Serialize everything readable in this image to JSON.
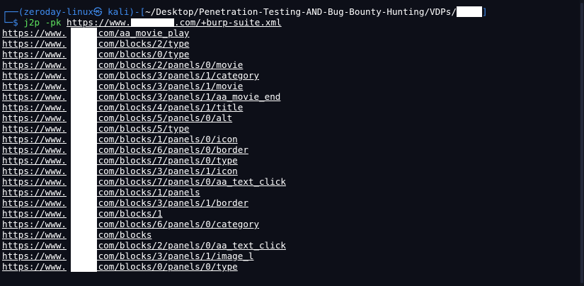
{
  "prompt": {
    "frame_top": "┌──(",
    "user_host": "zeroday-linux㉿ kali",
    "frame_mid": ")-[",
    "path": "~/Desktop/Penetration-Testing-AND-Bug-Bounty-Hunting/VDPs/",
    "frame_end": "]",
    "frame_bottom": "└─",
    "symbol": "$ "
  },
  "command": {
    "name": "j2p",
    "flag": "-pk",
    "arg_prefix": "https://www.",
    "arg_suffix": ".com/+burp-suite.xml"
  },
  "output": {
    "url_prefix": "https://www.",
    "url_domain_suffix": ".com",
    "paths": [
      "/aa_movie_play",
      "/blocks/2/type",
      "/blocks/0/type",
      "/blocks/2/panels/0/movie",
      "/blocks/3/panels/1/category",
      "/blocks/3/panels/1/movie",
      "/blocks/3/panels/1/aa_movie_end",
      "/blocks/4/panels/1/title",
      "/blocks/5/panels/0/alt",
      "/blocks/5/type",
      "/blocks/1/panels/0/icon",
      "/blocks/6/panels/0/border",
      "/blocks/7/panels/0/type",
      "/blocks/3/panels/1/icon",
      "/blocks/7/panels/0/aa_text_click",
      "/blocks/1/panels",
      "/blocks/3/panels/1/border",
      "/blocks/1",
      "/blocks/6/panels/0/category",
      "/blocks",
      "/blocks/2/panels/0/aa_text_click",
      "/blocks/3/panels/1/image_l",
      "/blocks/0/panels/0/type"
    ]
  },
  "colors": {
    "background": "#0d0f18",
    "prompt_frame": "#3f8cf0",
    "command": "#5ee45e",
    "text": "#ffffff",
    "redaction": "#ffffff"
  }
}
